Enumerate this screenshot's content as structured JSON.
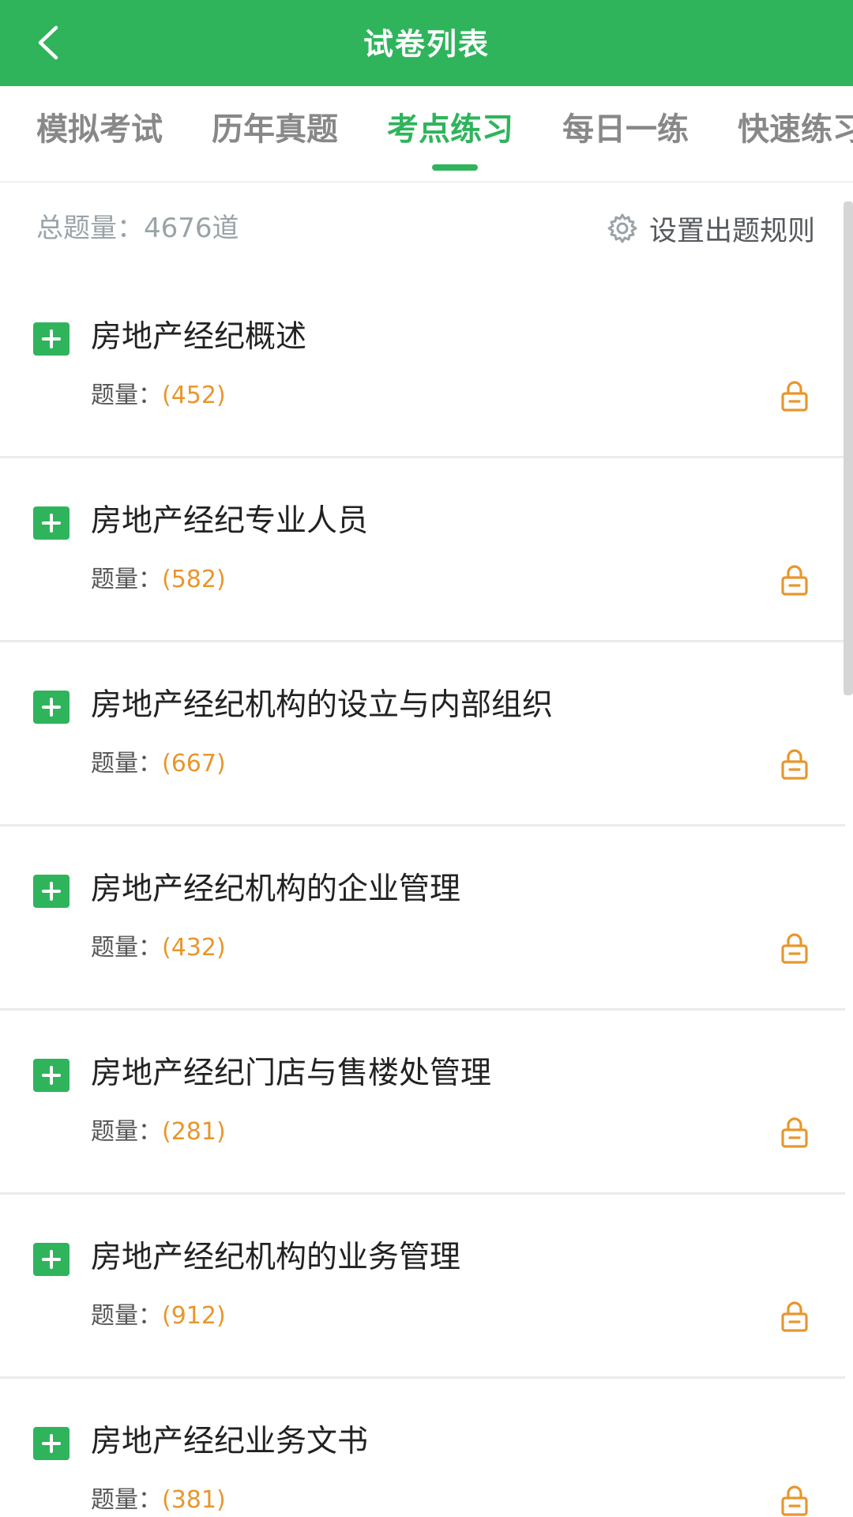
{
  "header": {
    "title": "试卷列表",
    "bg_color": "#2fb45c",
    "back_icon": "chevron-left-icon"
  },
  "tabs": [
    {
      "label": "模拟考试",
      "active": false
    },
    {
      "label": "历年真题",
      "active": false
    },
    {
      "label": "考点练习",
      "active": true
    },
    {
      "label": "每日一练",
      "active": false
    },
    {
      "label": "快速练习",
      "active": false
    }
  ],
  "summary": {
    "total_label": "总题量：4676道",
    "rules_label": "设置出题规则",
    "rules_icon": "gear-icon"
  },
  "items": [
    {
      "title": "房地产经纪概述",
      "count_label": "题量：",
      "count": "(452)"
    },
    {
      "title": "房地产经纪专业人员",
      "count_label": "题量：",
      "count": "(582)"
    },
    {
      "title": "房地产经纪机构的设立与内部组织",
      "count_label": "题量：",
      "count": "(667)"
    },
    {
      "title": "房地产经纪机构的企业管理",
      "count_label": "题量：",
      "count": "(432)"
    },
    {
      "title": "房地产经纪门店与售楼处管理",
      "count_label": "题量：",
      "count": "(281)"
    },
    {
      "title": "房地产经纪机构的业务管理",
      "count_label": "题量：",
      "count": "(912)"
    },
    {
      "title": "房地产经纪业务文书",
      "count_label": "题量：",
      "count": "(381)"
    }
  ],
  "colors": {
    "accent": "#2fb45c",
    "count": "#e8962c",
    "lock": "#e8962c"
  }
}
